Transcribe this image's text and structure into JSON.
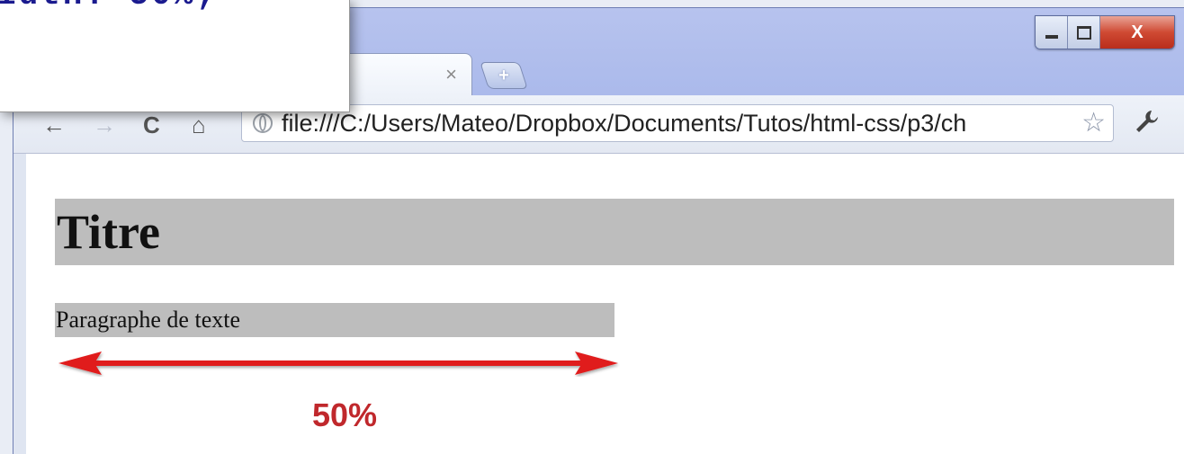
{
  "code_window": {
    "visible_text": "idth: 50%;"
  },
  "browser": {
    "tab": {
      "close_symbol": "×"
    },
    "new_tab_symbol": "+",
    "window_controls": {
      "close_symbol": "X"
    },
    "toolbar": {
      "back_symbol": "←",
      "forward_symbol": "→",
      "reload_symbol": "C",
      "home_symbol": "⌂",
      "url": "file:///C:/Users/Mateo/Dropbox/Documents/Tutos/html-css/p3/ch",
      "star_symbol": "☆",
      "wrench_symbol": "🔧"
    }
  },
  "page": {
    "heading": "Titre",
    "paragraph": "Paragraphe de texte",
    "width_annotation": "50%",
    "annotation_color": "#e01a1a"
  },
  "icons": {
    "globe": "globe-icon",
    "star": "star-icon",
    "wrench": "wrench-icon"
  }
}
